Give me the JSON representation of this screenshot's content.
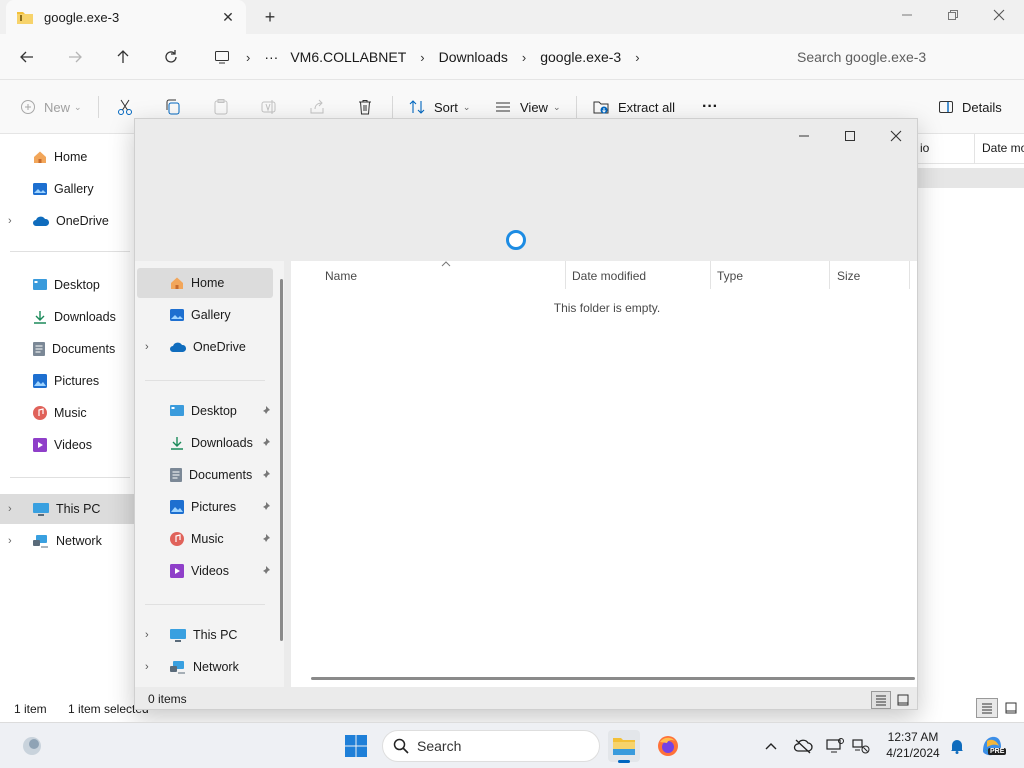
{
  "window": {
    "tab_title": "google.exe-3",
    "new_tab": "+",
    "controls": {
      "minimize": "minimize",
      "maximize": "restore",
      "close": "close"
    }
  },
  "breadcrumb": {
    "more": "···",
    "items": [
      "VM6.COLLABNET",
      "Downloads",
      "google.exe-3"
    ]
  },
  "search": {
    "placeholder": "Search google.exe-3"
  },
  "commandbar": {
    "new_label": "New",
    "sort_label": "Sort",
    "view_label": "View",
    "extract_label": "Extract all",
    "more_label": "···",
    "details_label": "Details"
  },
  "sidebar": {
    "items": [
      {
        "label": "Home"
      },
      {
        "label": "Gallery"
      },
      {
        "label": "OneDrive"
      },
      {
        "label": "Desktop"
      },
      {
        "label": "Downloads"
      },
      {
        "label": "Documents"
      },
      {
        "label": "Pictures"
      },
      {
        "label": "Music"
      },
      {
        "label": "Videos"
      },
      {
        "label": "This PC"
      },
      {
        "label": "Network"
      }
    ]
  },
  "bg_columns": {
    "partial1": "io",
    "partial2": "Date mo"
  },
  "status": {
    "count": "1 item",
    "selected": "1 item selected"
  },
  "dialog": {
    "nav": [
      {
        "label": "Home"
      },
      {
        "label": "Gallery"
      },
      {
        "label": "OneDrive"
      },
      {
        "label": "Desktop"
      },
      {
        "label": "Downloads"
      },
      {
        "label": "Documents"
      },
      {
        "label": "Pictures"
      },
      {
        "label": "Music"
      },
      {
        "label": "Videos"
      },
      {
        "label": "This PC"
      },
      {
        "label": "Network"
      }
    ],
    "columns": [
      "Name",
      "Date modified",
      "Type",
      "Size"
    ],
    "empty_message": "This folder is empty.",
    "status": "0 items"
  },
  "taskbar": {
    "search_label": "Search",
    "time": "12:37 AM",
    "date": "4/21/2024",
    "copilot_badge": "PRE"
  },
  "colors": {
    "accent": "#0067c0",
    "folder_yellow": "#f3c037",
    "selected_bg": "#dcdcdc"
  }
}
